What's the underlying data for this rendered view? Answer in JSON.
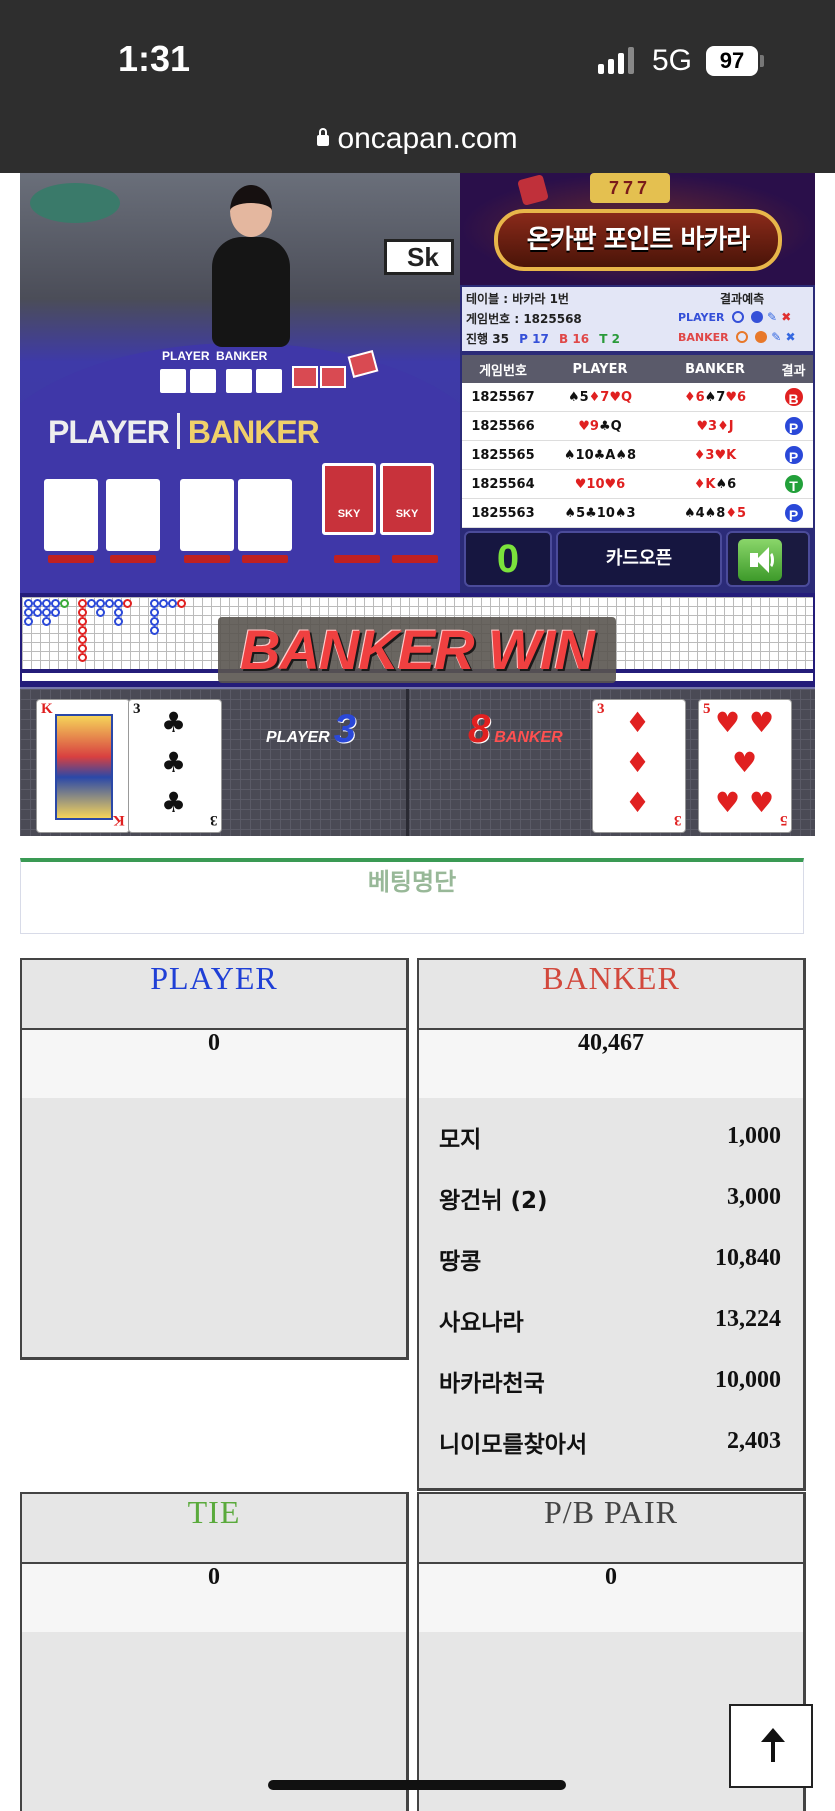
{
  "status": {
    "time": "1:31",
    "network": "5G",
    "battery": "97"
  },
  "browser": {
    "url": "oncapan.com"
  },
  "game": {
    "video": {
      "sign_text": "Sk",
      "table_label_player": "PLAYER",
      "table_label_banker": "BANKER",
      "header_player": "PLAYER",
      "header_banker": "BANKER",
      "card_back": "SKY"
    },
    "logo_text": "온카판 포인트 바카라",
    "logo_slot": "777",
    "info": {
      "table_line": "테이블 : 바카라 1번",
      "game_no_line": "게임번호 : 1825568",
      "progress_line": "진행 35",
      "p_count": "P 17",
      "b_count": "B 16",
      "t_count": "T 2",
      "prediction_label": "결과예측",
      "pred_player": "PLAYER",
      "pred_banker": "BANKER"
    },
    "results_header": {
      "game_no": "게임번호",
      "player": "PLAYER",
      "banker": "BANKER",
      "result": "결과"
    },
    "results": [
      {
        "no": "1825567",
        "player": [
          [
            "♠5",
            "blk"
          ],
          [
            "♦7",
            "red"
          ],
          [
            "♥Q",
            "red"
          ]
        ],
        "banker": [
          [
            "♦6",
            "red"
          ],
          [
            "♠7",
            "blk"
          ],
          [
            "♥6",
            "red"
          ]
        ],
        "result": "B"
      },
      {
        "no": "1825566",
        "player": [
          [
            "♥9",
            "red"
          ],
          [
            "♣Q",
            "blk"
          ]
        ],
        "banker": [
          [
            "♥3",
            "red"
          ],
          [
            "♦J",
            "red"
          ]
        ],
        "result": "P"
      },
      {
        "no": "1825565",
        "player": [
          [
            "♠10",
            "blk"
          ],
          [
            "♣A",
            "blk"
          ],
          [
            "♠8",
            "blk"
          ]
        ],
        "banker": [
          [
            "♦3",
            "red"
          ],
          [
            "♥K",
            "red"
          ]
        ],
        "result": "P"
      },
      {
        "no": "1825564",
        "player": [
          [
            "♥10",
            "red"
          ],
          [
            "♥6",
            "red"
          ]
        ],
        "banker": [
          [
            "♦K",
            "red"
          ],
          [
            "♠6",
            "blk"
          ]
        ],
        "result": "T"
      },
      {
        "no": "1825563",
        "player": [
          [
            "♠5",
            "blk"
          ],
          [
            "♣10",
            "blk"
          ],
          [
            "♠3",
            "blk"
          ]
        ],
        "banker": [
          [
            "♠4",
            "blk"
          ],
          [
            "♠8",
            "blk"
          ],
          [
            "♦5",
            "red"
          ]
        ],
        "result": "P"
      }
    ],
    "counter": "0",
    "card_open_label": "카드오픈",
    "win_banner": "BANKER WIN",
    "player_score_label": "PLAYER",
    "player_score": "3",
    "banker_score_label": "BANKER",
    "banker_score": "8",
    "player_cards": [
      {
        "rank": "K",
        "suit": "♥",
        "color": "red"
      },
      {
        "rank": "3",
        "suit": "♣",
        "color": "blk"
      }
    ],
    "banker_cards": [
      {
        "rank": "3",
        "suit": "♦",
        "color": "red"
      },
      {
        "rank": "5",
        "suit": "♥",
        "color": "red"
      }
    ]
  },
  "betting": {
    "title": "베팅명단",
    "player": {
      "header": "PLAYER",
      "color": "#1f3fd6",
      "total": "0"
    },
    "banker": {
      "header": "BANKER",
      "color": "#d2483c",
      "total": "40,467",
      "bets": [
        {
          "name": "모지",
          "amount": "1,000"
        },
        {
          "name": "왕건뉘 (2)",
          "amount": "3,000"
        },
        {
          "name": "땅콩",
          "amount": "10,840"
        },
        {
          "name": "사요나라",
          "amount": "13,224"
        },
        {
          "name": "바카라천국",
          "amount": "10,000"
        },
        {
          "name": "니이모를찾아서",
          "amount": "2,403"
        }
      ]
    },
    "tie": {
      "header": "TIE",
      "color": "#5aaa3c",
      "total": "0"
    },
    "pair": {
      "header": "P/B PAIR",
      "color": "#444444",
      "total": "0"
    }
  }
}
